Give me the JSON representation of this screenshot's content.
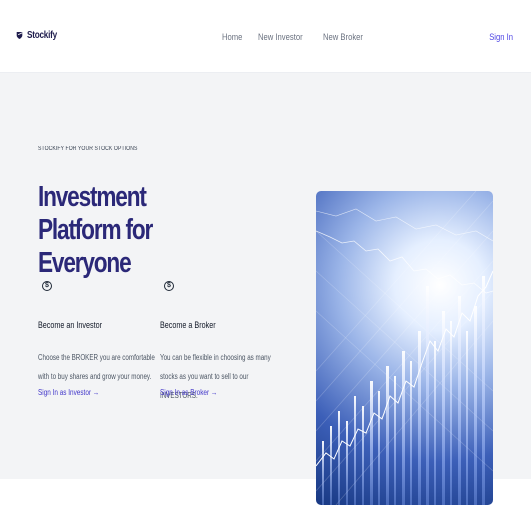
{
  "nav": {
    "brand": "Stockify",
    "logo_icon": "shield-icon",
    "links": [
      "Home",
      "New Investor",
      "New Broker"
    ],
    "signin": "Sign In"
  },
  "hero": {
    "eyebrow": "STOCKIFY FOR YOUR STOCK OPTIONS",
    "title": "Investment Platform for Everyone",
    "image_alt": "stock market chart graphic",
    "features": [
      {
        "icon": "dollar-circle-icon",
        "title": "Become an Investor",
        "description": "Choose the BROKER you are comfortable with to buy shares and grow your money.",
        "link": "Sign In as Investor →"
      },
      {
        "icon": "dollar-circle-icon",
        "title": "Become a Broker",
        "description": "You can be flexible in choosing as many stocks as you want to sell to our INVESTORS.",
        "link": "Sign In as Broker →"
      }
    ]
  },
  "colors": {
    "accent": "#4f46e5",
    "headline": "#2b2878",
    "hero_bg": "#f3f4f6"
  }
}
